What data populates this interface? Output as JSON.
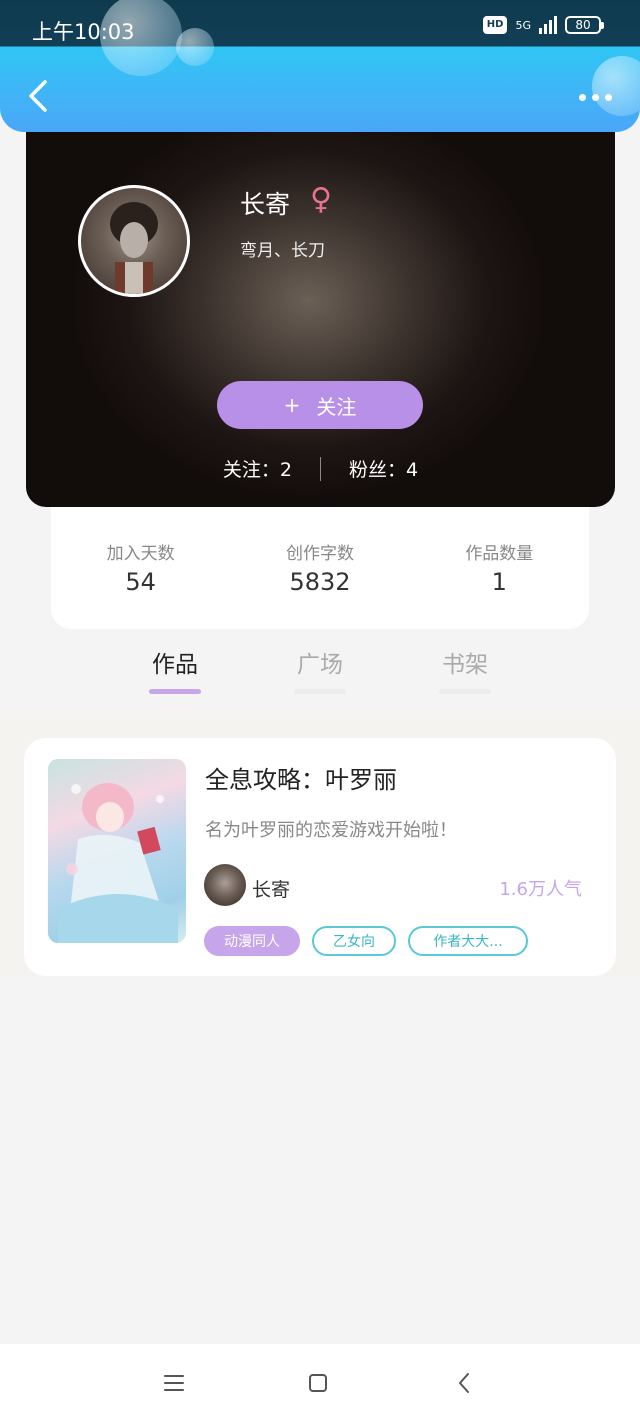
{
  "status_bar": {
    "time": "上午10:03",
    "hd_label": "HD",
    "network": "5G",
    "battery": "80"
  },
  "header": {
    "back_icon": "chevron-left-icon",
    "more_icon": "more-horizontal-icon"
  },
  "profile": {
    "name": "长寄",
    "gender_symbol": "♀",
    "bio": "弯月、长刀",
    "follow_plus": "+",
    "follow_label": "关注",
    "following": "关注：2",
    "followers": "粉丝：4"
  },
  "stats": [
    {
      "label": "加入天数",
      "value": "54"
    },
    {
      "label": "创作字数",
      "value": "5832"
    },
    {
      "label": "作品数量",
      "value": "1"
    }
  ],
  "tabs": [
    {
      "label": "作品",
      "active": true
    },
    {
      "label": "广场",
      "active": false
    },
    {
      "label": "书架",
      "active": false
    }
  ],
  "work": {
    "title": "全息攻略：叶罗丽",
    "description": "名为叶罗丽的恋爱游戏开始啦！",
    "author": "长寄",
    "popularity": "1.6万人气",
    "tags": [
      "动漫同人",
      "乙女向",
      "作者大大..."
    ]
  },
  "colors": {
    "accent": "#c7a5ea",
    "follow_button": "#b990e8",
    "tag_outline": "#58c9d6",
    "header_blue": "#3fb6f6"
  }
}
